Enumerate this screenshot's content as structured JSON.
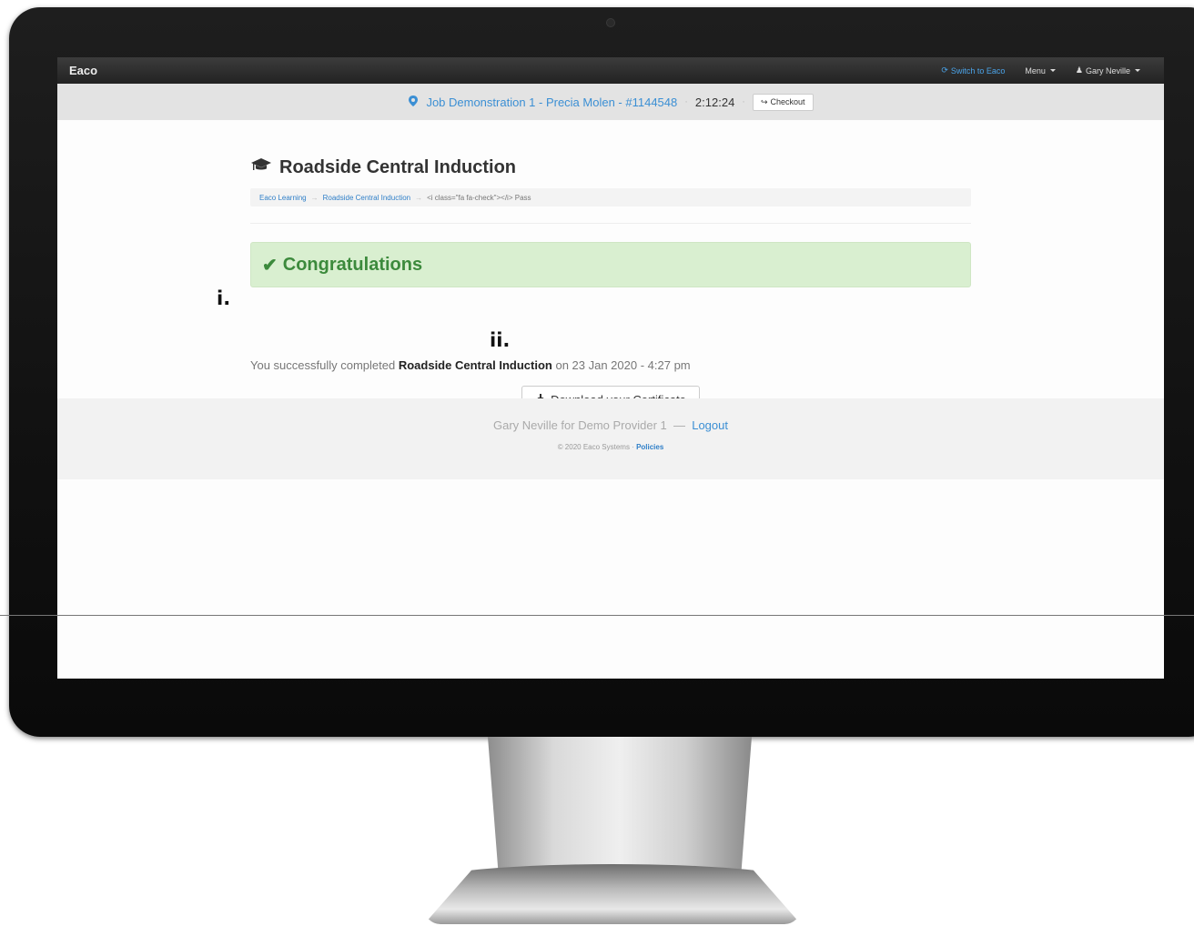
{
  "navbar": {
    "brand": "Eaco",
    "switch_label": "Switch to Eaco",
    "menu_label": "Menu",
    "user_label": "Gary Neville"
  },
  "jobbar": {
    "job_label": "Job Demonstration 1 - Precia Molen - #1144548",
    "separator": "·",
    "timer": "2:12:24",
    "checkout_label": "Checkout"
  },
  "page": {
    "title": "Roadside Central Induction",
    "breadcrumb": {
      "root": "Eaco Learning",
      "course": "Roadside Central Induction",
      "current": "<i class=\"fa fa-check\"></i> Pass"
    },
    "alert_title": "Congratulations",
    "message_prefix": "You successfully completed ",
    "message_course": "Roadside Central Induction",
    "message_suffix": " on 23 Jan 2020 - 4:27 pm",
    "download_label": "Download your Certificate"
  },
  "footer": {
    "user_line": "Gary Neville for Demo Provider 1",
    "dash": "—",
    "logout_label": "Logout",
    "copyright": "© 2020 Eaco Systems · ",
    "policies_label": "Policies"
  },
  "annotations": {
    "first": "i.",
    "second": "ii."
  },
  "colors": {
    "accent": "#3b8fd4",
    "success": "#3c8a3c",
    "success_bg": "#d9efd0"
  }
}
